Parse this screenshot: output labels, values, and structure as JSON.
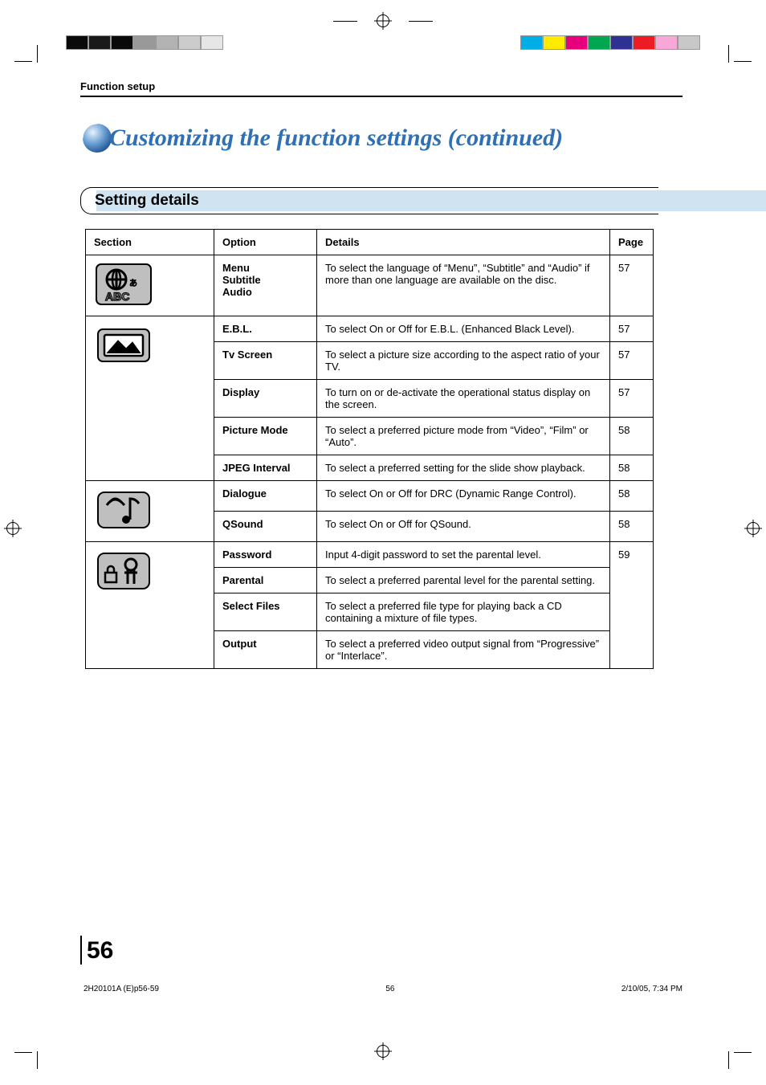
{
  "crumb": "Function setup",
  "page_title": "Customizing the function settings (continued)",
  "section_heading": "Setting details",
  "headers": {
    "section": "Section",
    "option": "Option",
    "details": "Details",
    "page": "Page"
  },
  "rows": {
    "lang": {
      "option_lines": [
        "Menu",
        "Subtitle",
        "Audio"
      ],
      "details": "To select the language of “Menu”, “Subtitle” and “Audio” if more than one language are available on the disc.",
      "page": "57"
    },
    "ebl": {
      "option": "E.B.L.",
      "details": "To select On or Off for E.B.L. (Enhanced Black Level).",
      "page": "57"
    },
    "tvscreen": {
      "option": "Tv Screen",
      "details": "To select a picture size according to the aspect ratio of your TV.",
      "page": "57"
    },
    "display": {
      "option": "Display",
      "details": "To turn on or de-activate the operational status display on the screen.",
      "page": "57"
    },
    "picmode": {
      "option": "Picture Mode",
      "details": "To select a preferred picture mode from “Video”, “Film” or “Auto”.",
      "page": "58"
    },
    "jpeg": {
      "option": "JPEG Interval",
      "details": "To select a preferred setting for the slide show playback.",
      "page": "58"
    },
    "dialogue": {
      "option": "Dialogue",
      "details": "To select On or Off for DRC (Dynamic Range Control).",
      "page": "58"
    },
    "qsound": {
      "option": "QSound",
      "details": "To select On or Off for QSound.",
      "page": "58"
    },
    "password": {
      "option": "Password",
      "details": "Input 4-digit password to set the parental level."
    },
    "parental": {
      "option": "Parental",
      "details": "To select a preferred parental level for the parental setting."
    },
    "selfiles": {
      "option": "Select Files",
      "details": "To select a preferred file type for playing back a CD containing a mixture of file types."
    },
    "output": {
      "option": "Output",
      "details": "To select a preferred video output signal from “Progressive” or “Interlace”."
    },
    "parental_group_page": "59"
  },
  "page_number": "56",
  "footer": {
    "left": "2H20101A (E)p56-59",
    "mid": "56",
    "right": "2/10/05, 7:34 PM"
  }
}
